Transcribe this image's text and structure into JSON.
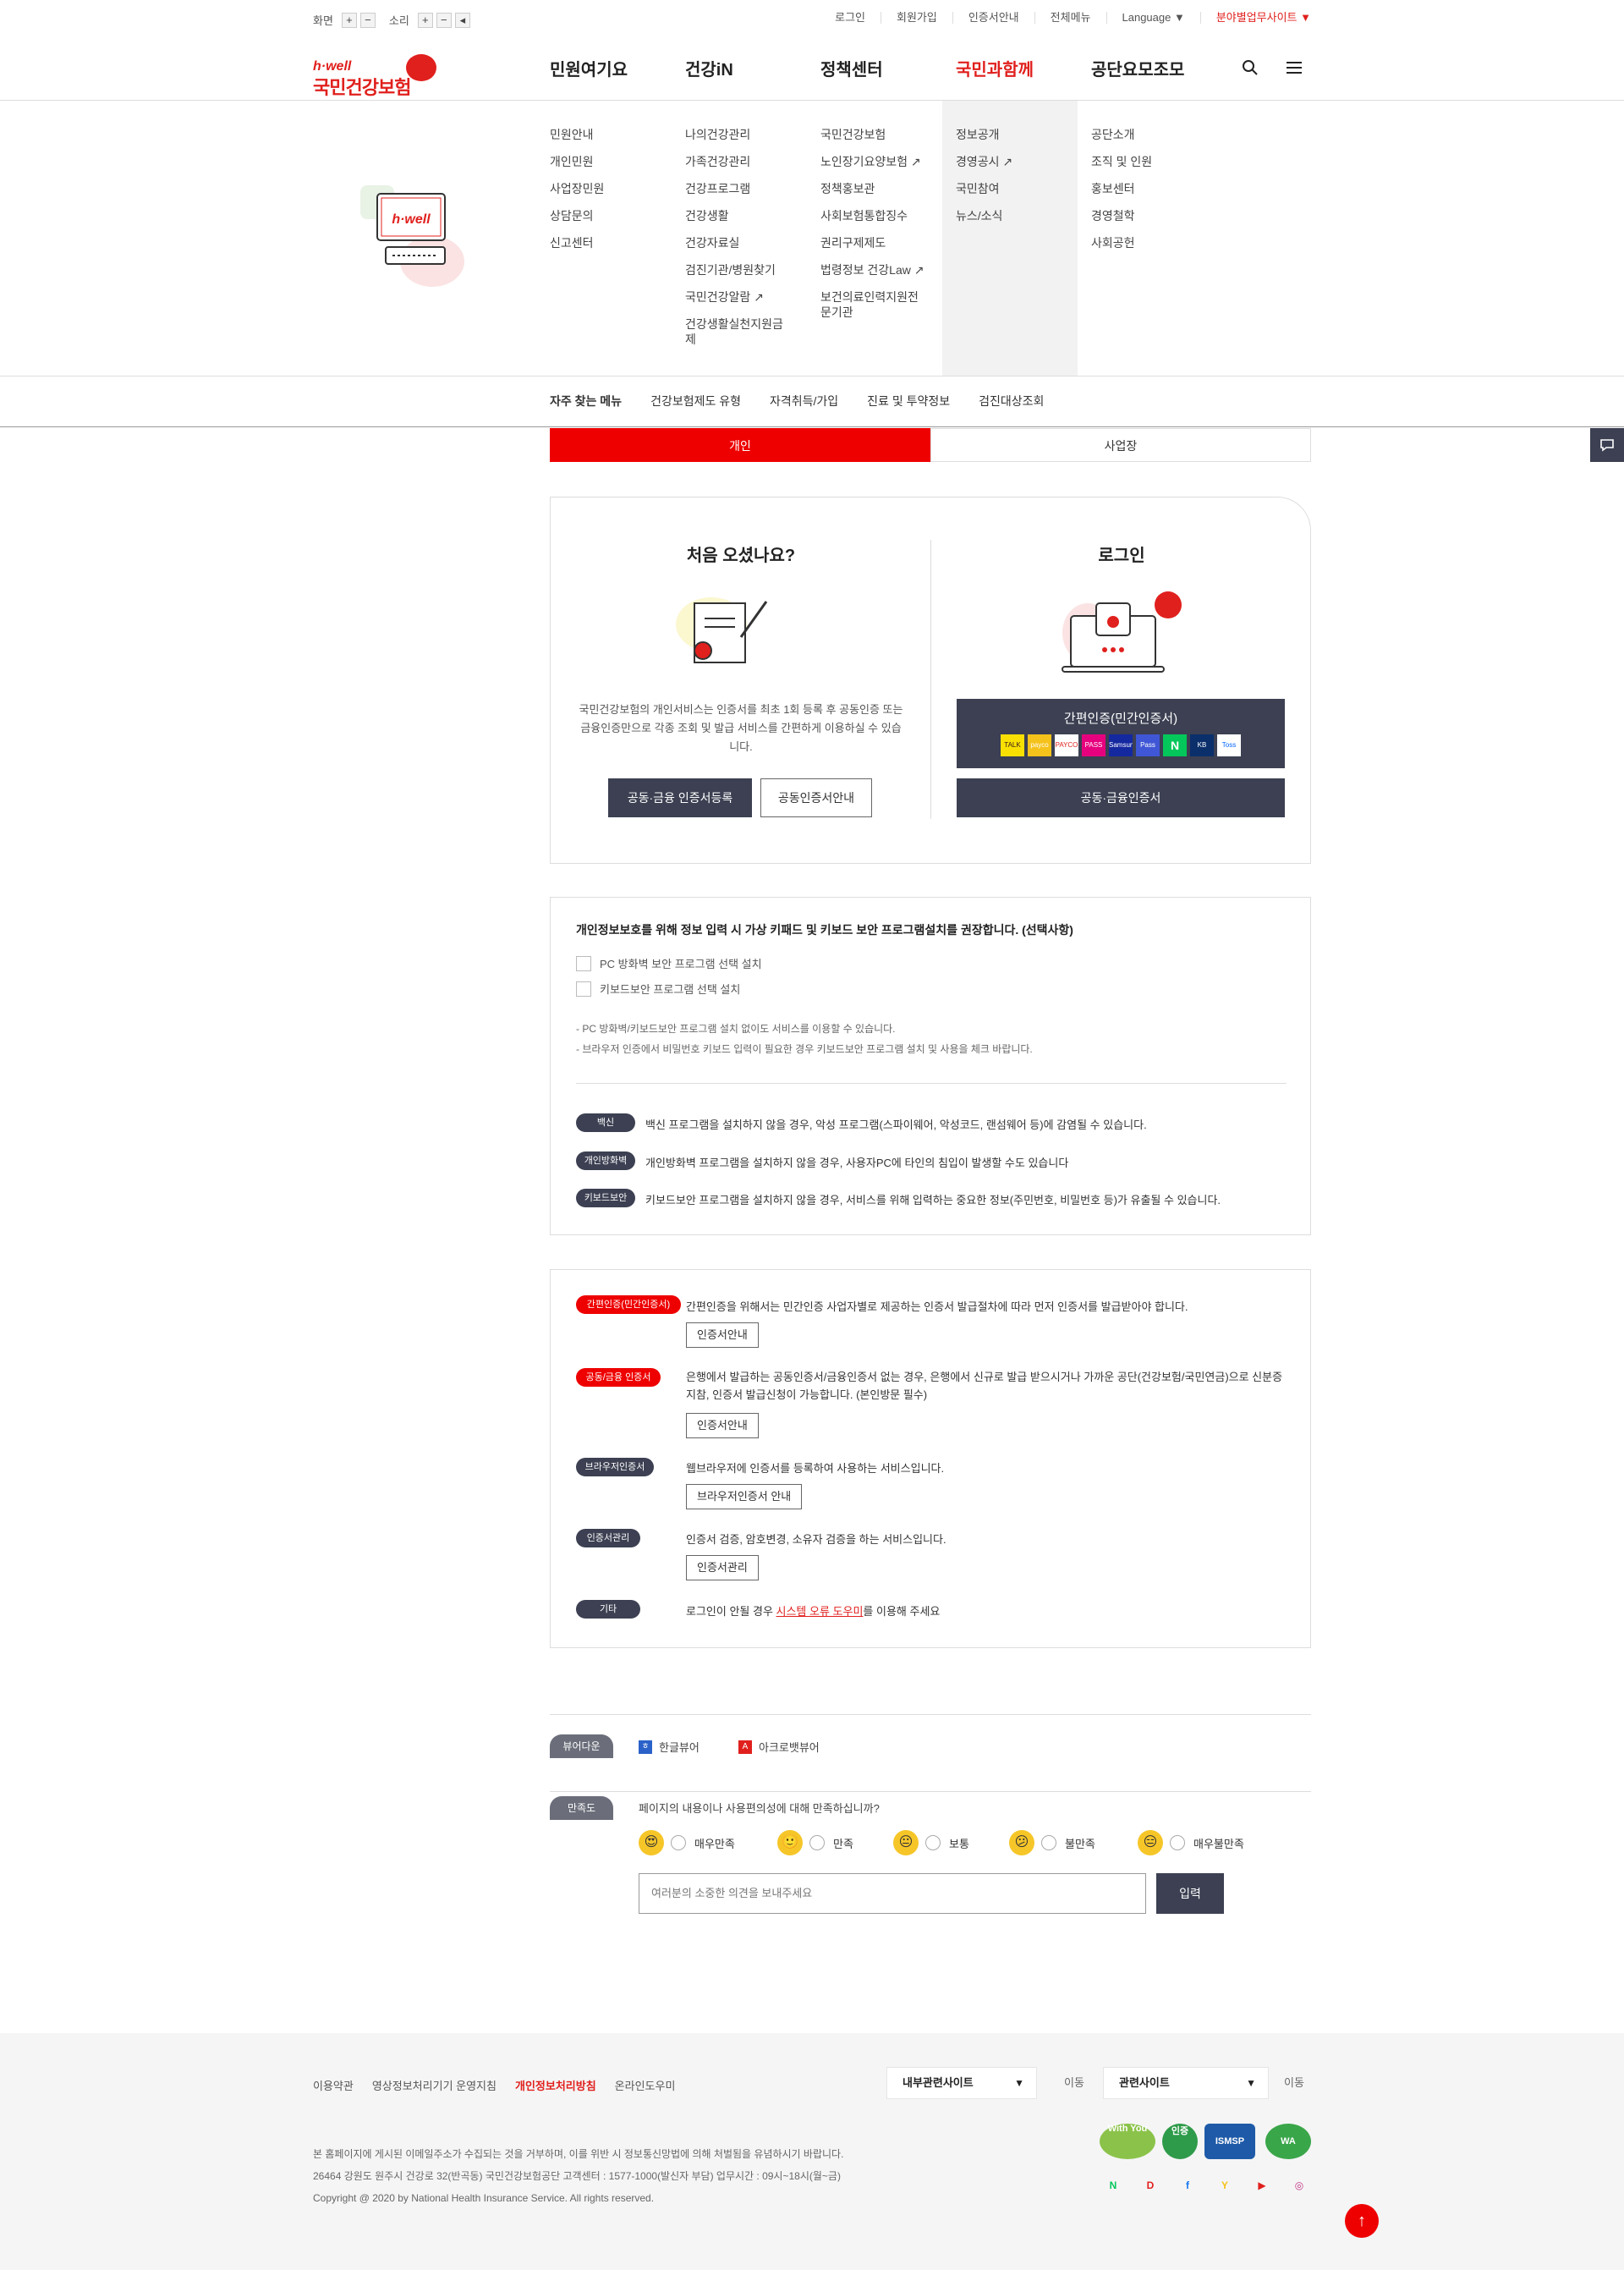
{
  "util": {
    "screen_label": "화면",
    "sound_label": "소리",
    "plus": "+",
    "minus": "−",
    "links": [
      "로그인",
      "회원가입",
      "인증서안내",
      "전체메뉴",
      "Language ▼",
      "분야별업무사이트 ▼"
    ]
  },
  "logo": {
    "small": "h·well",
    "big": "국민건강보험"
  },
  "gnb": [
    "민원여기요",
    "건강iN",
    "정책센터",
    "국민과함께",
    "공단요모조모"
  ],
  "mega": {
    "col1": [
      "민원안내",
      "개인민원",
      "사업장민원",
      "상담문의",
      "신고센터"
    ],
    "col2": [
      "나의건강관리",
      "가족건강관리",
      "건강프로그램",
      "건강생활",
      "건강자료실",
      "검진기관/병원찾기",
      "국민건강알람 ↗",
      "건강생활실천지원금제"
    ],
    "col3": [
      "국민건강보험",
      "노인장기요양보험 ↗",
      "정책홍보관",
      "사회보험통합징수",
      "권리구제제도",
      "법령정보 건강Law ↗",
      "보건의료인력지원전문기관"
    ],
    "col4": [
      "정보공개",
      "경영공시 ↗",
      "국민참여",
      "뉴스/소식"
    ],
    "col5": [
      "공단소개",
      "조직 및 인원",
      "홍보센터",
      "경영철학",
      "사회공헌"
    ],
    "illus_text": "h·well"
  },
  "freq": [
    "자주 찾는 메뉴",
    "건강보험제도 유형",
    "자격취득/가입",
    "진료 및 투약정보",
    "검진대상조회"
  ],
  "tabs": [
    "개인",
    "사업장"
  ],
  "login": {
    "left_title": "처음 오셨나요?",
    "left_desc": "국민건강보험의 개인서비스는 인증서를 최초 1회 등록 후 공동인증 또는 금융인증만으로 각종 조회 및 발급 서비스를 간편하게 이용하실 수 있습니다.",
    "register_btn": "공동·금융 인증서등록",
    "guide_btn": "공동인증서안내",
    "right_title": "로그인",
    "simple_btn": "간편인증(민간인증서)",
    "pay_icons": [
      "TALK",
      "payco",
      "PAYCO",
      "PASS",
      "Samsung",
      "Pass",
      "N",
      "KB",
      "Toss"
    ],
    "cert_btn": "공동·금융인증서"
  },
  "security": {
    "title": "개인정보보호를 위해 정보 입력 시 가상 키패드 및 키보드 보안 프로그램설치를 권장합니다. (선택사항)",
    "checks": [
      "PC 방화벽 보안 프로그램 선택 설치",
      "키보드보안 프로그램 선택 설치"
    ],
    "notes": [
      "- PC 방화벽/키보드보안 프로그램 설치 없이도 서비스를 이용할 수 있습니다.",
      "- 브라우저 인증에서 비밀번호 키보드 입력이 필요한 경우 키보드보안 프로그램 설치 및 사용을 체크 바랍니다."
    ],
    "rows": [
      {
        "tag": "백신",
        "text": "백신 프로그램을 설치하지 않을 경우, 악성 프로그램(스파이웨어, 악성코드, 랜섬웨어 등)에 감염될 수 있습니다."
      },
      {
        "tag": "개인방화벽",
        "text": "개인방화벽 프로그램을 설치하지 않을 경우, 사용자PC에 타인의 침입이 발생할 수도 있습니다"
      },
      {
        "tag": "키보드보안",
        "text": "키보드보안 프로그램을 설치하지 않을 경우, 서비스를 위해 입력하는 중요한 정보(주민번호, 비밀번호 등)가 유출될 수 있습니다."
      }
    ]
  },
  "cert": {
    "rows": [
      {
        "tag": "간편인증(민간인증서)",
        "text": "간편인증을 위해서는 민간인증 사업자별로 제공하는 인증서 발급절차에 따라 먼저 인증서를 발급받아야 합니다.",
        "btn": "인증서안내"
      },
      {
        "tag": "공동/금융 인증서",
        "text": "은행에서 발급하는 공동인증서/금융인증서 없는 경우, 은행에서 신규로 발급 받으시거나 가까운 공단(건강보험/국민연금)으로 신분증 지참, 인증서 발급신청이 가능합니다. (본인방문 필수)",
        "btn": "인증서안내"
      },
      {
        "tag": "브라우저인증서",
        "text": "웹브라우저에 인증서를 등록하여 사용하는 서비스입니다.",
        "btn": "브라우저인증서 안내"
      },
      {
        "tag": "인증서관리",
        "text": "인증서 검증, 암호변경, 소유자 검증을 하는 서비스입니다.",
        "btn": "인증서관리"
      }
    ],
    "etc_tag": "기타",
    "etc_pre": "로그인이 안될 경우 ",
    "etc_link": "시스템 오류 도우미",
    "etc_post": "를 이용해 주세요"
  },
  "viewer": {
    "tag": "뷰어다운",
    "hwp": "한글뷰어",
    "pdf": "아크로뱃뷰어"
  },
  "satisfaction": {
    "tag": "만족도",
    "question": "페이지의 내용이나 사용편의성에 대해 만족하십니까?",
    "options": [
      "매우만족",
      "만족",
      "보통",
      "불만족",
      "매우불만족"
    ],
    "placeholder": "여러분의 소중한 의견을 보내주세요",
    "submit": "입력"
  },
  "footer": {
    "links": [
      "이용약관",
      "영상정보처리기기 운영지침",
      "개인정보처리방침",
      "온라인도우미"
    ],
    "select1": "내부관련사이트",
    "select2": "관련사이트",
    "go": "이동",
    "info1": "본 홈페이지에 게시된 이메일주소가 수집되는 것을 거부하며, 이를 위반 시 정보통신망법에 의해 처벌됨을 유념하시기 바랍니다.",
    "info2": "26464 강원도 원주시 건강로 32(반곡동) 국민건강보험공단 고객센터 : 1577-1000(발신자 부담) 업무시간 : 09시~18시(월~금)",
    "info3": "Copyright @ 2020 by National Health Insurance Service. All rights reserved.",
    "badges": [
      "With You",
      "인증",
      "ISMSP",
      "WA"
    ],
    "sns": [
      "N",
      "D",
      "f",
      "Y",
      "▶",
      "◎"
    ]
  }
}
